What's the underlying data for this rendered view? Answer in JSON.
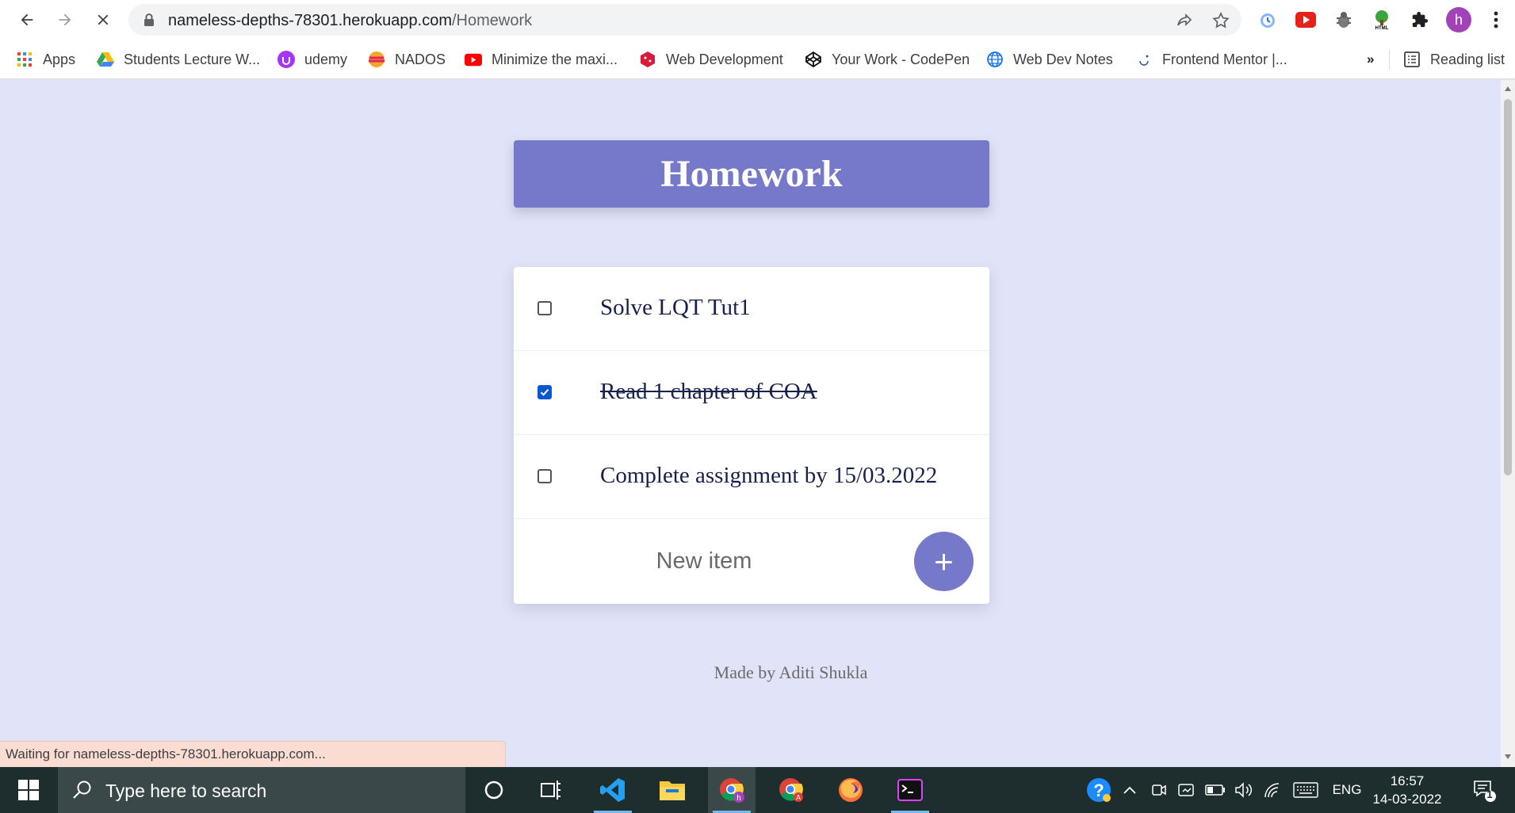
{
  "browser": {
    "url_host": "nameless-depths-78301.herokuapp.com",
    "url_path": "/Homework",
    "bookmarks": [
      {
        "label": "Apps",
        "icon": "apps-grid-icon"
      },
      {
        "label": "Students Lecture W...",
        "icon": "google-drive-icon"
      },
      {
        "label": "udemy",
        "icon": "udemy-icon"
      },
      {
        "label": "NADOS",
        "icon": "nados-icon"
      },
      {
        "label": "Minimize the maxi...",
        "icon": "youtube-icon"
      },
      {
        "label": "Web Development",
        "icon": "web-dev-icon"
      },
      {
        "label": "Your Work - CodePen",
        "icon": "codepen-icon"
      },
      {
        "label": "Web Dev Notes",
        "icon": "globe-icon"
      },
      {
        "label": "Frontend Mentor |...",
        "icon": "frontend-mentor-icon"
      }
    ],
    "overflow": "»",
    "reading_list": "Reading list",
    "profile_initial": "h"
  },
  "app": {
    "title": "Homework",
    "items": [
      {
        "text": "Solve LQT Tut1",
        "checked": false
      },
      {
        "text": "Read 1 chapter of COA",
        "checked": true
      },
      {
        "text": "Complete assignment by 15/03.2022",
        "checked": false
      }
    ],
    "new_item_placeholder": "New item",
    "add_label": "+",
    "footer": "Made by Aditi Shukla"
  },
  "status_bar": "Waiting for nameless-depths-78301.herokuapp.com...",
  "taskbar": {
    "search_placeholder": "Type here to search",
    "language": "ENG",
    "time": "16:57",
    "date": "14-03-2022",
    "notification_count": "1"
  },
  "colors": {
    "page_bg": "#e1e4f8",
    "accent": "#7678c9",
    "item_text": "#18214d"
  }
}
